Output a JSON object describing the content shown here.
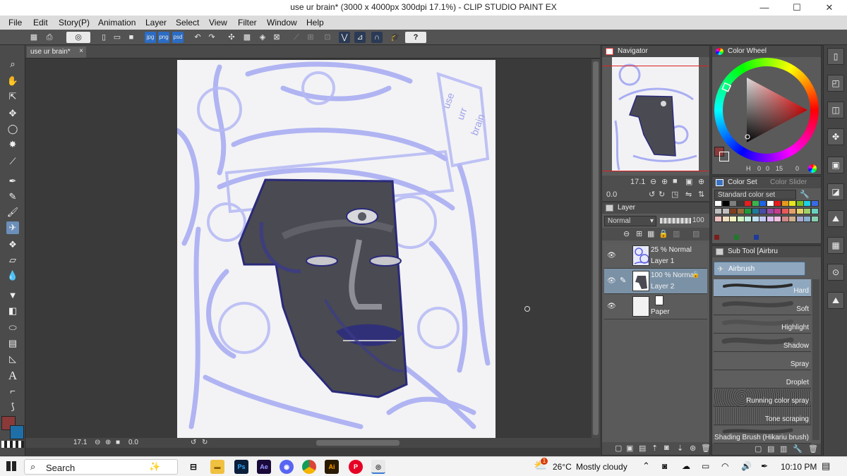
{
  "window": {
    "title": "use ur brain* (3000 x 4000px 300dpi 17.1%) - CLIP STUDIO PAINT EX",
    "minimize": "—",
    "maximize": "☐",
    "close": "✕"
  },
  "menu": [
    "File",
    "Edit",
    "Story(P)",
    "Animation",
    "Layer",
    "Select",
    "View",
    "Filter",
    "Window",
    "Help"
  ],
  "command_bar": {
    "icons": [
      "new-icon",
      "open-icon",
      "save-icon",
      "export-jpg-icon",
      "export-png-icon",
      "export-psd-icon",
      "undo-icon",
      "redo-icon",
      "transform-icon",
      "fill-icon",
      "clear-icon",
      "snap-ruler-icon",
      "snap-grid-icon",
      "lesson-icon",
      "help-icon"
    ],
    "jpg": "jpg",
    "png": "png",
    "psd": "psd"
  },
  "document_tab": {
    "label": "use ur brain*",
    "close": "×"
  },
  "artwork_text": {
    "line1": "use",
    "line2": "urr",
    "line3": "brain"
  },
  "canvas_status": {
    "zoom": "17.1",
    "angle": "0.0"
  },
  "navigator": {
    "title": "Navigator",
    "zoom": "17.1",
    "angle": "0.0"
  },
  "color_wheel": {
    "title": "Color Wheel",
    "h_label": "H",
    "h_value": "0",
    "s_value": "0",
    "l_value": "15",
    "v_value": "0",
    "main_color": "#8b3a3a",
    "sub_color": "#1e6fa8"
  },
  "color_set": {
    "title": "Color Set",
    "slider_tab": "Color Slider",
    "set_name": "Standard color set",
    "rows": [
      [
        "#ffffff",
        "#000000",
        "#7f7f7f",
        "#3a3a3a",
        "#e61e1e",
        "#39b54a",
        "#1e64e6",
        "#ffffff",
        "#e81a1a",
        "#e69a1e",
        "#e6e61e",
        "#7fbf1e",
        "#1ecfe6",
        "#3a6ae6"
      ],
      [
        "#bfbfbf",
        "#c0c0c0",
        "#7f3f1e",
        "#9a6a3a",
        "#1e9a3a",
        "#1e7a9a",
        "#4a4aa8",
        "#9a4aa8",
        "#c83a8a",
        "#e65a5a",
        "#e6a06a",
        "#e6d06a",
        "#a0d06a",
        "#6ad0c0"
      ],
      [
        "#f0c0c0",
        "#f0e0c0",
        "#f0f0c0",
        "#d0f0c0",
        "#c0f0e0",
        "#c0e0f0",
        "#c0c8f0",
        "#e0c0f0",
        "#f0c0e0",
        "#d08a8a",
        "#d0b08a",
        "#a8a8d0",
        "#8ab0d0",
        "#8ad0b0"
      ]
    ]
  },
  "layer_panel": {
    "title": "Layer",
    "blend_mode": "Normal",
    "opacity": "100",
    "layers": [
      {
        "mode": "25 % Normal",
        "name": "Layer 1"
      },
      {
        "mode": "100 % Normal",
        "name": "Layer 2"
      },
      {
        "mode": "",
        "name": "Paper"
      }
    ]
  },
  "sub_tool": {
    "title": "Sub Tool [Airbru",
    "group": "Airbrush",
    "brushes": [
      "Hard",
      "Soft",
      "Highlight",
      "Shadow",
      "Spray",
      "Droplet",
      "Running color spray",
      "Tone scraping",
      "Shading Brush (Hikariu brush)"
    ]
  },
  "taskbar": {
    "search_placeholder": "Search",
    "temperature": "26°C",
    "weather": "Mostly cloudy",
    "time": "10:10 PM",
    "app_ps": "Ps",
    "app_ae": "Ae",
    "app_ai": "Ai",
    "notification_badge": "1"
  }
}
